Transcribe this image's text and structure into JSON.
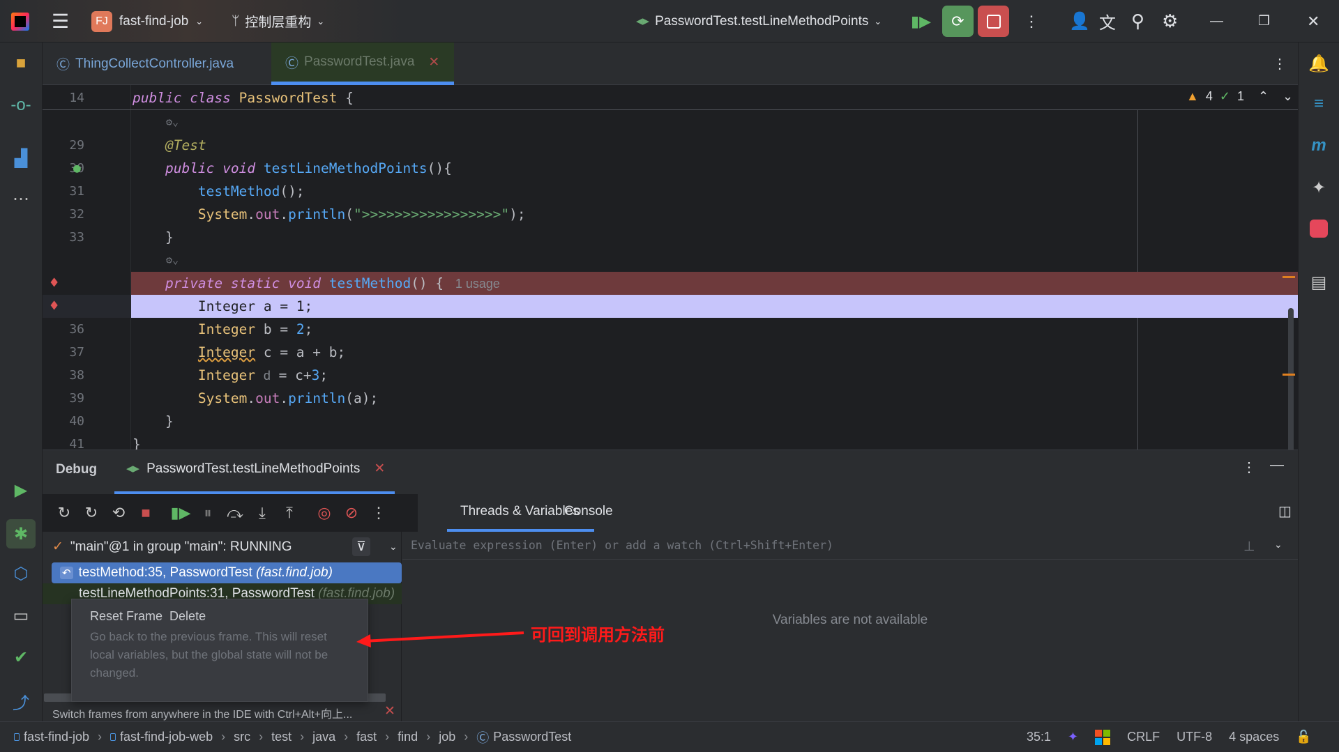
{
  "titlebar": {
    "project_badge": "FJ",
    "project": "fast-find-job",
    "branch": "控制层重构",
    "run_config": "PasswordTest.testLineMethodPoints"
  },
  "tabs": [
    {
      "label": "ThingCollectController.java",
      "active": false
    },
    {
      "label": "PasswordTest.java",
      "active": true
    }
  ],
  "editor": {
    "inspections": {
      "warnings": "4",
      "checks": "1"
    },
    "sticky": {
      "line": "14",
      "tokens": [
        [
          "public ",
          "kw"
        ],
        [
          "class ",
          "kw"
        ],
        [
          "PasswordTest ",
          "cl"
        ],
        [
          "{",
          "pl"
        ]
      ]
    },
    "lines": [
      {
        "n": "",
        "hint": true
      },
      {
        "n": "29",
        "tokens": [
          [
            "    ",
            "pl"
          ],
          [
            "@Test",
            "an"
          ]
        ]
      },
      {
        "n": "30",
        "tokens": [
          [
            "    ",
            "pl"
          ],
          [
            "public ",
            "kw"
          ],
          [
            "void ",
            "kw"
          ],
          [
            "testLineMethodPoints",
            "fn"
          ],
          [
            "(){",
            "pl"
          ]
        ]
      },
      {
        "n": "31",
        "tokens": [
          [
            "        ",
            "pl"
          ],
          [
            "testMethod",
            "fn"
          ],
          [
            "();",
            "pl"
          ]
        ]
      },
      {
        "n": "32",
        "tokens": [
          [
            "        ",
            "pl"
          ],
          [
            "System",
            "cl"
          ],
          [
            ".",
            "pl"
          ],
          [
            "out",
            "fd"
          ],
          [
            ".",
            "pl"
          ],
          [
            "println",
            "fn"
          ],
          [
            "(",
            "pl"
          ],
          [
            "\">>>>>>>>>>>>>>>>>\"",
            "st"
          ],
          [
            ");",
            "pl"
          ]
        ]
      },
      {
        "n": "33",
        "tokens": [
          [
            "    ",
            "pl"
          ],
          [
            "}",
            "pl"
          ]
        ]
      },
      {
        "n": "",
        "hint": true
      },
      {
        "n": "",
        "bp": true,
        "bg": "#6e3a3c",
        "tokens": [
          [
            "    ",
            "pl"
          ],
          [
            "private ",
            "kw"
          ],
          [
            "static ",
            "kw"
          ],
          [
            "void ",
            "kw"
          ],
          [
            "testMethod",
            "fn"
          ],
          [
            "() { ",
            "pl"
          ],
          [
            " 1 usage",
            "hint"
          ]
        ]
      },
      {
        "n": "",
        "bp": true,
        "bg": "#c7c5fb",
        "tokens": [
          [
            "        ",
            "pl"
          ],
          [
            "Integer a = 1;",
            "dk"
          ]
        ]
      },
      {
        "n": "36",
        "tokens": [
          [
            "        ",
            "pl"
          ],
          [
            "Integer ",
            "cl"
          ],
          [
            "b = ",
            "pl"
          ],
          [
            "2",
            "fn"
          ],
          [
            ";",
            "pl"
          ]
        ]
      },
      {
        "n": "37",
        "tokens": [
          [
            "        ",
            "pl"
          ],
          [
            "Integer",
            "cl sq"
          ],
          [
            " c = a + b;",
            "pl"
          ]
        ]
      },
      {
        "n": "38",
        "tokens": [
          [
            "        ",
            "pl"
          ],
          [
            "Integer ",
            "cl"
          ],
          [
            "d",
            "hint"
          ],
          [
            " = c+",
            "pl"
          ],
          [
            "3",
            "fn"
          ],
          [
            ";",
            "pl"
          ]
        ]
      },
      {
        "n": "39",
        "tokens": [
          [
            "        ",
            "pl"
          ],
          [
            "System",
            "cl"
          ],
          [
            ".",
            "pl"
          ],
          [
            "out",
            "fd"
          ],
          [
            ".",
            "pl"
          ],
          [
            "println",
            "fn"
          ],
          [
            "(a);",
            "pl"
          ]
        ]
      },
      {
        "n": "40",
        "tokens": [
          [
            "    ",
            "pl"
          ],
          [
            "}",
            "pl"
          ]
        ]
      },
      {
        "n": "41",
        "tokens": [
          [
            "}",
            "pl"
          ]
        ]
      }
    ]
  },
  "debug": {
    "title": "Debug",
    "session": "PasswordTest.testLineMethodPoints",
    "tabs": [
      "Threads & Variables",
      "Console"
    ],
    "thread": "\"main\"@1 in group \"main\": RUNNING",
    "frames": [
      {
        "name": "testMethod:35, PasswordTest ",
        "pkg": "(fast.find.job)"
      },
      {
        "name": "testLineMethodPoints:31, PasswordTest ",
        "pkg": "(fast.find.job)"
      }
    ],
    "eval_placeholder": "Evaluate expression (Enter) or add a watch (Ctrl+Shift+Enter)",
    "vars_empty": "Variables are not available",
    "hint_bar": "Switch frames from anywhere in the IDE with Ctrl+Alt+向上...",
    "tooltip": {
      "title": "Reset Frame",
      "shortcut": "Delete",
      "body": "Go back to the previous frame. This will reset local variables, but the global state will not be changed."
    },
    "annotation": "可回到调用方法前"
  },
  "status": {
    "crumbs": [
      "fast-find-job",
      "fast-find-job-web",
      "src",
      "test",
      "java",
      "fast",
      "find",
      "job",
      "PasswordTest"
    ],
    "position": "35:1",
    "line_sep": "CRLF",
    "encoding": "UTF-8",
    "indent": "4 spaces"
  }
}
